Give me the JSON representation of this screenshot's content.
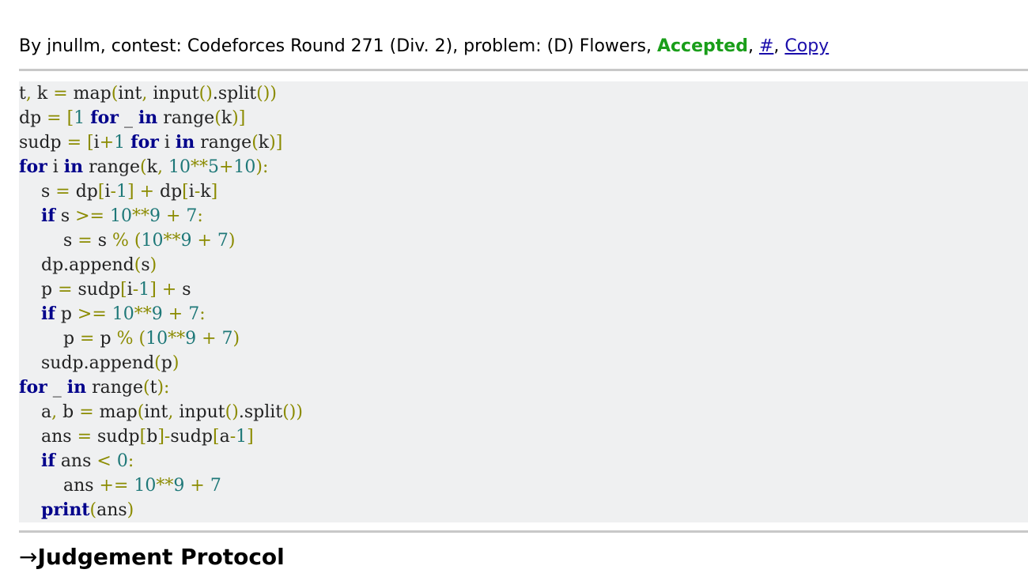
{
  "submission": {
    "by_prefix": "By ",
    "author": "jnullm",
    "contest_prefix": ", contest: ",
    "contest": "Codeforces Round 271 (Div. 2)",
    "problem_prefix": ", problem: ",
    "problem": "(D) Flowers",
    "sep1": ", ",
    "verdict": "Accepted",
    "sep2": ", ",
    "hash_link": "#",
    "sep3": ", ",
    "copy_link": "Copy"
  },
  "colors": {
    "verdict": "#1a9e1a",
    "link": "#1a0dab",
    "code_background": "#eff0f1",
    "keyword": "#00008b",
    "number": "#1e7878",
    "operator": "#8b8b00"
  },
  "code": {
    "language": "python",
    "lines": [
      "t, k = map(int, input().split())",
      "dp = [1 for _ in range(k)]",
      "sudp = [i+1 for i in range(k)]",
      "for i in range(k, 10**5+10):",
      "    s = dp[i-1] + dp[i-k]",
      "    if s >= 10**9 + 7:",
      "        s = s % (10**9 + 7)",
      "    dp.append(s)",
      "    p = sudp[i-1] + s",
      "    if p >= 10**9 + 7:",
      "        p = p % (10**9 + 7)",
      "    sudp.append(p)",
      "for _ in range(t):",
      "    a, b = map(int, input().split())",
      "    ans = sudp[b]-sudp[a-1]",
      "    if ans < 0:",
      "        ans += 10**9 + 7",
      "    print(ans)"
    ]
  },
  "judgement": {
    "arrow": "→",
    "title": "Judgement Protocol"
  }
}
